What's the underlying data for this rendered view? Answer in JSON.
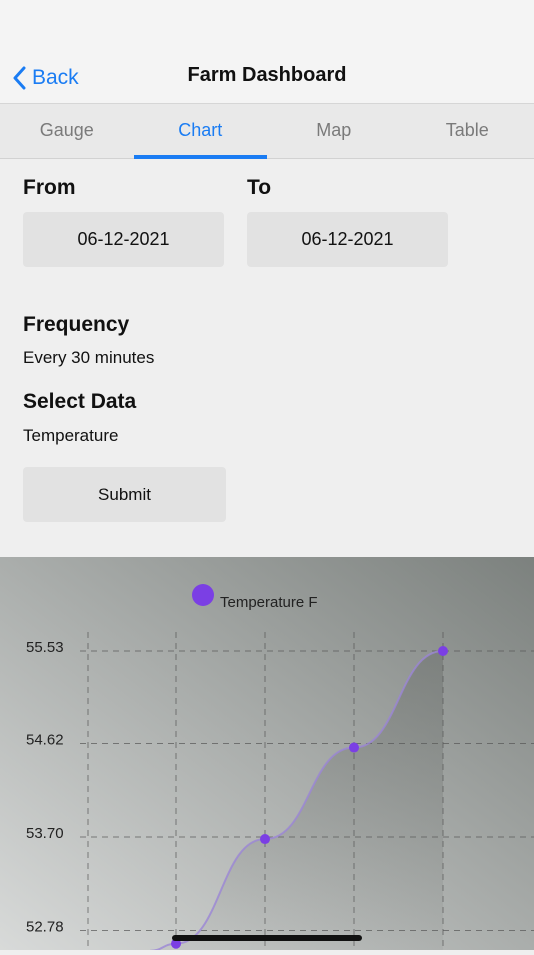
{
  "header": {
    "back_label": "Back",
    "title": "Farm Dashboard"
  },
  "tabs": [
    {
      "label": "Gauge",
      "active": false
    },
    {
      "label": "Chart",
      "active": true
    },
    {
      "label": "Map",
      "active": false
    },
    {
      "label": "Table",
      "active": false
    }
  ],
  "form": {
    "from_label": "From",
    "from_value": "06-12-2021",
    "to_label": "To",
    "to_value": "06-12-2021",
    "frequency_label": "Frequency",
    "frequency_value": "Every 30 minutes",
    "select_data_label": "Select Data",
    "select_data_value": "Temperature",
    "submit_label": "Submit"
  },
  "colors": {
    "accent": "#1a7cf3",
    "series": "#7b3fe4"
  },
  "chart_data": {
    "type": "line",
    "legend": "Temperature F",
    "legend_position": "top",
    "yticks": [
      "55.53",
      "54.62",
      "53.70",
      "52.78"
    ],
    "ylim_visible": [
      52.78,
      55.53
    ],
    "grid": true,
    "series": [
      {
        "name": "Temperature F",
        "values": [
          52.65,
          53.68,
          54.58,
          55.53
        ]
      }
    ]
  }
}
